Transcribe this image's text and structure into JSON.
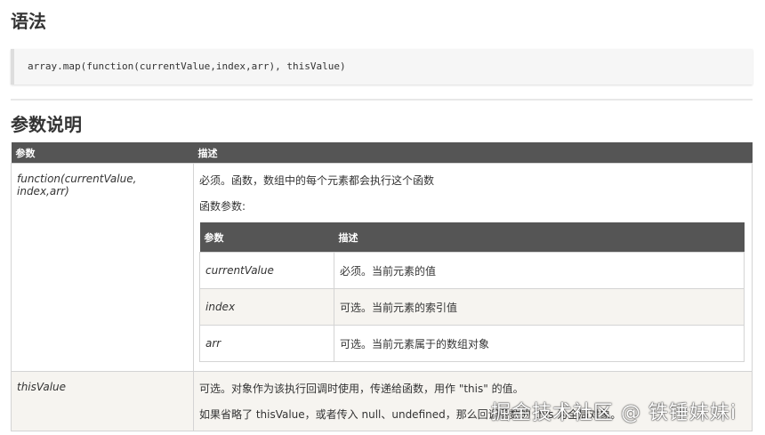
{
  "syntax_heading": "语法",
  "code": "array.map(function(currentValue,index,arr), thisValue)",
  "params_heading": "参数说明",
  "table": {
    "headers": [
      "参数",
      "描述"
    ],
    "rows": [
      {
        "param": "function(currentValue, index,arr)",
        "desc": [
          "必须。函数，数组中的每个元素都会执行这个函数",
          "函数参数:"
        ],
        "inner": {
          "headers": [
            "参数",
            "描述"
          ],
          "rows": [
            {
              "param": "currentValue",
              "desc": "必须。当前元素的值"
            },
            {
              "param": "index",
              "desc": "可选。当前元素的索引值"
            },
            {
              "param": "arr",
              "desc": "可选。当前元素属于的数组对象"
            }
          ]
        }
      },
      {
        "param": "thisValue",
        "desc": [
          "可选。对象作为该执行回调时使用，传递给函数，用作 \"this\" 的值。",
          "如果省略了 thisValue，或者传入 null、undefined，那么回调函数的 this 为全局对象。"
        ]
      }
    ]
  },
  "watermark": "掘金技术社区 @ 铁锤妹妹i"
}
